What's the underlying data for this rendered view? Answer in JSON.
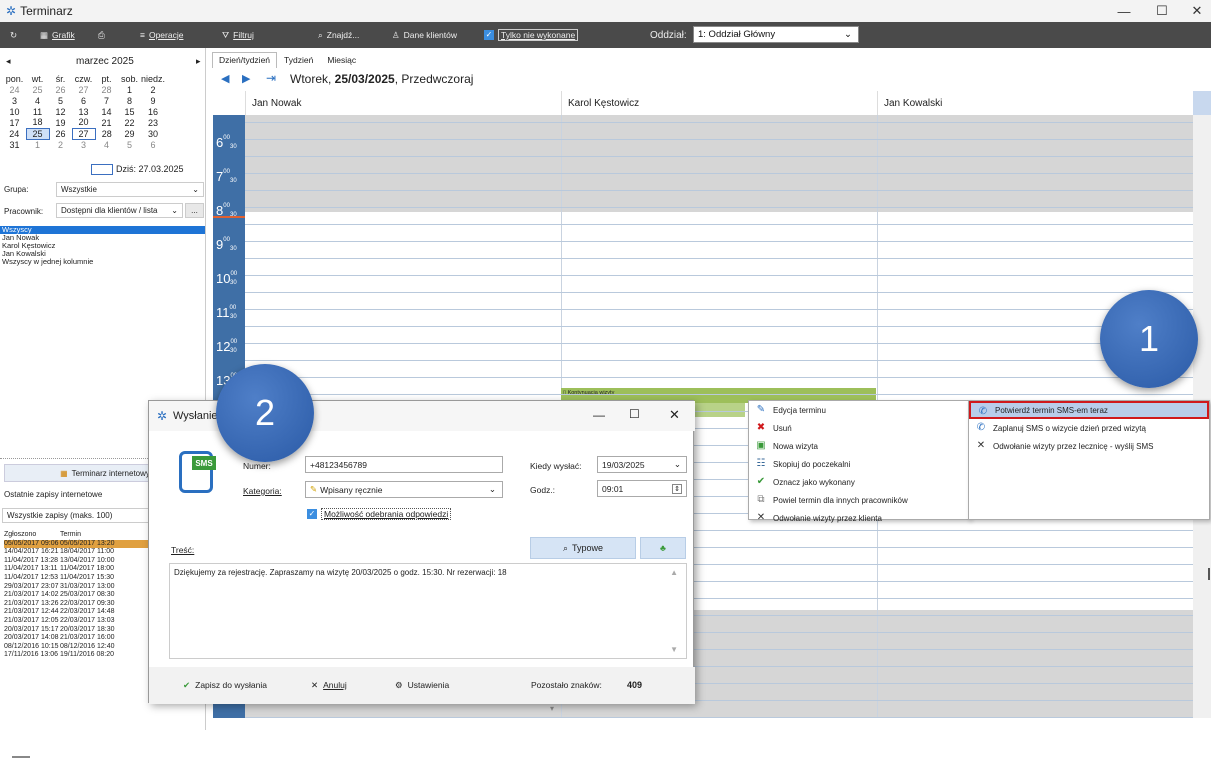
{
  "window": {
    "title": "Terminarz"
  },
  "toolbar": {
    "grafik": "Grafik",
    "operacje": "Operacje",
    "filtruj": "Filtruj",
    "znajdz": "Znajdź...",
    "dane_klientow": "Dane klientów",
    "tylko_niewykonane": "Tylko nie wykonane",
    "oddzial_label": "Oddział:",
    "oddzial_value": "1: Oddział Główny"
  },
  "calendar": {
    "month": "marzec 2025",
    "weekdays": [
      "pon.",
      "wt.",
      "śr.",
      "czw.",
      "pt.",
      "sob.",
      "niedz."
    ],
    "weeks": [
      [
        "24",
        "25",
        "26",
        "27",
        "28",
        "1",
        "2"
      ],
      [
        "3",
        "4",
        "5",
        "6",
        "7",
        "8",
        "9"
      ],
      [
        "10",
        "11",
        "12",
        "13",
        "14",
        "15",
        "16"
      ],
      [
        "17",
        "18",
        "19",
        "20",
        "21",
        "22",
        "23"
      ],
      [
        "24",
        "25",
        "26",
        "27",
        "28",
        "29",
        "30"
      ],
      [
        "31",
        "1",
        "2",
        "3",
        "4",
        "5",
        "6"
      ]
    ],
    "today": "Dziś: 27.03.2025"
  },
  "filters": {
    "grupa_label": "Grupa:",
    "grupa_value": "Wszystkie",
    "pracownik_label": "Pracownik:",
    "pracownik_value": "Dostępni dla klientów / lista",
    "more": "...",
    "list": [
      "Wszyscy",
      "Jan Nowak",
      "Karol Kęstowicz",
      "Jan Kowalski",
      "Wszyscy w jednej kolumnie"
    ]
  },
  "internet": {
    "button": "Terminarz internetowy",
    "title": "Ostatnie zapisy internetowe",
    "select": "Wszystkie zapisy (maks. 100)",
    "col1": "Zgłoszono",
    "col2": "Termin",
    "rows": [
      [
        "05/05/2017 09:06",
        "05/05/2017 13:20"
      ],
      [
        "14/04/2017 16:21",
        "18/04/2017 11:00"
      ],
      [
        "11/04/2017 13:28",
        "13/04/2017 10:00"
      ],
      [
        "11/04/2017 13:11",
        "11/04/2017 18:00"
      ],
      [
        "11/04/2017 12:53",
        "11/04/2017 15:30"
      ],
      [
        "29/03/2017 23:07",
        "31/03/2017 13:00"
      ],
      [
        "21/03/2017 14:02",
        "25/03/2017 08:30"
      ],
      [
        "21/03/2017 13:26",
        "22/03/2017 09:30"
      ],
      [
        "21/03/2017 12:44",
        "22/03/2017 14:48"
      ],
      [
        "21/03/2017 12:05",
        "22/03/2017 13:03"
      ],
      [
        "20/03/2017 15:17",
        "20/03/2017 18:30"
      ],
      [
        "20/03/2017 14:08",
        "21/03/2017 16:00"
      ],
      [
        "08/12/2016 10:15",
        "08/12/2016 12:40"
      ],
      [
        "17/11/2016 13:06",
        "19/11/2016 08:20"
      ]
    ]
  },
  "schedule": {
    "tabs": [
      "Dzień/tydzień",
      "Tydzień",
      "Miesiąc"
    ],
    "date_bold": "25/03/2025",
    "date_prefix": "Wtorek, ",
    "date_suffix": ", Przedwczoraj",
    "columns": [
      "Jan Nowak",
      "Karol Kęstowicz",
      "Jan Kowalski"
    ],
    "hours": [
      "6",
      "7",
      "8",
      "9",
      "10",
      "11",
      "12",
      "13"
    ],
    "minutes_top": "00",
    "minutes_half": "30",
    "appointment": "Kontynuacja wizyty"
  },
  "context_menu": {
    "items": [
      "Edycja terminu",
      "Usuń",
      "Nowa wizyta",
      "Skopiuj do poczekalni",
      "Oznacz jako wykonany",
      "Powiel termin dla innych pracowników",
      "Odwołanie wizyty przez klienta"
    ]
  },
  "submenu": {
    "items": [
      "Potwierdź termin SMS-em teraz",
      "Zaplanuj SMS o wizycie dzień przed wizytą",
      "Odwołanie wizyty przez lecznicę - wyślij SMS"
    ]
  },
  "badges": {
    "one": "1",
    "two": "2"
  },
  "dialog": {
    "title": "Wysłanie",
    "sms": "SMS",
    "numer_label": "Numer:",
    "numer_value": "+48123456789",
    "kategoria_label": "Kategoria:",
    "kategoria_value": "Wpisany ręcznie",
    "checkbox": "Możliwość odebrania odpowiedzi",
    "kiedy_label": "Kiedy wysłać:",
    "kiedy_value": "19/03/2025",
    "godz_label": "Godz.:",
    "godz_value": "09:01",
    "tresc_label": "Treść:",
    "typowe": "Typowe",
    "message": "Dziękujemy za rejestrację. Zapraszamy na wizytę 20/03/2025 o godz. 15:30. Nr rezerwacji: 18",
    "zapisz": "Zapisz do wysłania",
    "anuluj": "Anuluj",
    "ustawienia": "Ustawienia",
    "pozostalo_label": "Pozostało znaków:",
    "pozostalo_value": "409"
  },
  "colors": {
    "accent": "#3f6fa6",
    "toolbar": "#4a4a4a",
    "appointment": "#9dbf5a",
    "highlight": "#e0a040",
    "submenu_red": "#d0191c"
  }
}
